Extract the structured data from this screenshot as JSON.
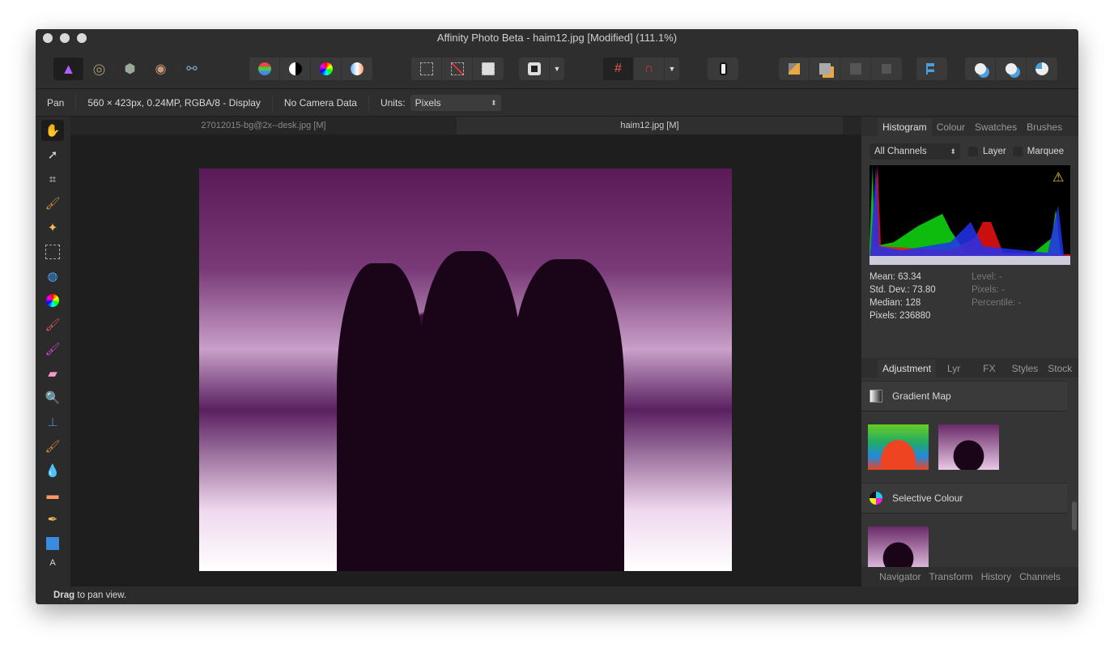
{
  "window": {
    "title": "Affinity Photo Beta - haim12.jpg [Modified] (111.1%)"
  },
  "toolbar": {
    "personas": [
      "affinity-photo-persona-icon",
      "liquify-persona-icon",
      "develop-persona-icon",
      "tone-mapping-persona-icon",
      "export-persona-icon"
    ]
  },
  "context": {
    "tool": "Pan",
    "info": "560 × 423px, 0.24MP, RGBA/8 - Display",
    "camera": "No Camera Data",
    "units_label": "Units:",
    "units_value": "Pixels"
  },
  "documents": [
    {
      "label": "27012015-bg@2x--desk.jpg [M]",
      "active": false
    },
    {
      "label": "haim12.jpg [M]",
      "active": true
    }
  ],
  "status": {
    "bold": "Drag",
    "text": " to pan view."
  },
  "histogram_panel": {
    "tabs": [
      "Histogram",
      "Colour",
      "Swatches",
      "Brushes"
    ],
    "channel": "All Channels",
    "layer_label": "Layer",
    "marquee_label": "Marquee",
    "stats": {
      "mean": "Mean: 63.34",
      "std": "Std. Dev.: 73.80",
      "median": "Median: 128",
      "pixels": "Pixels: 236880",
      "level": "Level: -",
      "pixels_sel": "Pixels: -",
      "percentile": "Percentile: -"
    }
  },
  "adjustment_panel": {
    "tabs": [
      "Adjustment",
      "Lyr",
      "FX",
      "Styles",
      "Stock"
    ],
    "sections": [
      {
        "label": "Gradient Map"
      },
      {
        "label": "Selective Colour"
      }
    ]
  },
  "bottom_tabs": [
    "Navigator",
    "Transform",
    "History",
    "Channels"
  ],
  "colors": {
    "accent": "#4a9ede",
    "image_tint": "#7a2a78"
  }
}
